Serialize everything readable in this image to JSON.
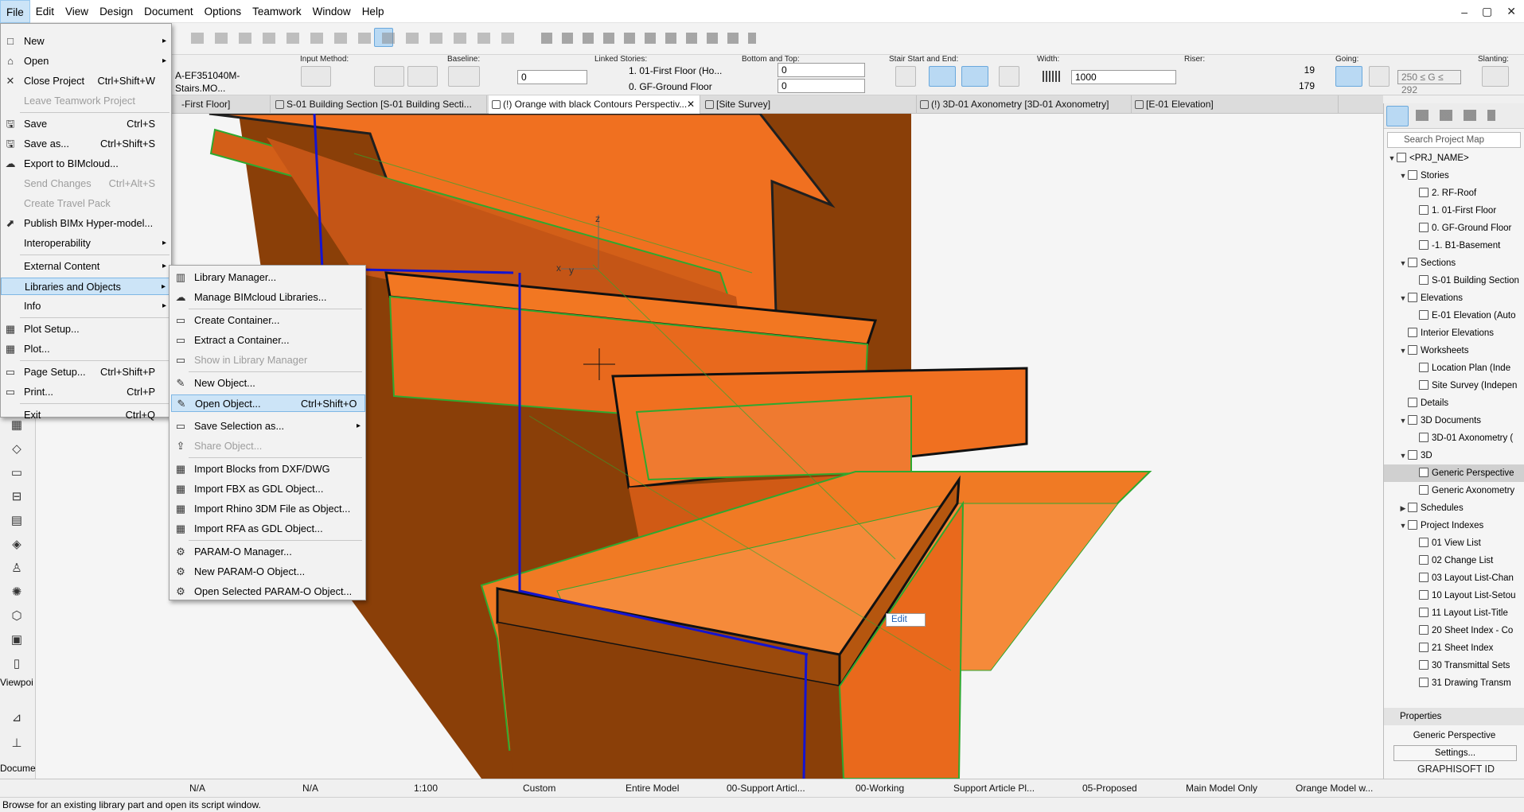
{
  "menubar": [
    "File",
    "Edit",
    "View",
    "Design",
    "Document",
    "Options",
    "Teamwork",
    "Window",
    "Help"
  ],
  "window_controls": [
    "–",
    "▢",
    "✕"
  ],
  "infobox": {
    "element_id": "A-EF351040M- Stairs.MO...",
    "sections": {
      "input_method": "Input Method:",
      "baseline": "Baseline:",
      "linked_stories": "Linked Stories:",
      "bottom_top": "Bottom and Top:",
      "stair_start_end": "Stair Start and End:",
      "width": "Width:",
      "riser": "Riser:",
      "going": "Going:",
      "slanting": "Slanting:"
    },
    "baseline_value": "0",
    "linked_story_top": "1. 01-First Floor (Ho...",
    "linked_story_bottom": "0. GF-Ground Floor",
    "bottom_value": "0",
    "top_value": "0",
    "width_value": "1000",
    "riser_count": "19",
    "riser_height": "179",
    "going_range": "250 ≤ G ≤ 292"
  },
  "tabs": [
    {
      "label": "-First Floor]"
    },
    {
      "label": "S-01 Building Section [S-01 Building Secti..."
    },
    {
      "label": "(!) Orange with black Contours Perspectiv...",
      "close": "✕"
    },
    {
      "label": "[Site Survey]"
    },
    {
      "label": "(!) 3D-01 Axonometry [3D-01 Axonometry]"
    },
    {
      "label": "[E-01 Elevation]"
    }
  ],
  "file_menu": {
    "items": [
      {
        "label": "New",
        "arrow": true
      },
      {
        "label": "Open",
        "arrow": true
      },
      {
        "label": "Close Project",
        "shortcut": "Ctrl+Shift+W"
      },
      {
        "label": "Leave Teamwork Project",
        "disabled": true
      },
      {
        "label": "Save",
        "shortcut": "Ctrl+S"
      },
      {
        "label": "Save as...",
        "shortcut": "Ctrl+Shift+S"
      },
      {
        "label": "Export to BIMcloud..."
      },
      {
        "label": "Send Changes",
        "shortcut": "Ctrl+Alt+S",
        "disabled": true
      },
      {
        "label": "Create Travel Pack",
        "disabled": true
      },
      {
        "label": "Publish BIMx Hyper-model..."
      },
      {
        "label": "Interoperability",
        "arrow": true
      },
      {
        "label": "External Content",
        "arrow": true
      },
      {
        "label": "Libraries and Objects",
        "arrow": true,
        "highlight": true
      },
      {
        "label": "Info",
        "arrow": true
      },
      {
        "label": "Plot Setup..."
      },
      {
        "label": "Plot..."
      },
      {
        "label": "Page Setup...",
        "shortcut": "Ctrl+Shift+P"
      },
      {
        "label": "Print...",
        "shortcut": "Ctrl+P"
      },
      {
        "label": "Exit",
        "shortcut": "Ctrl+Q"
      }
    ]
  },
  "libraries_submenu": {
    "items": [
      {
        "label": "Library Manager..."
      },
      {
        "label": "Manage BIMcloud Libraries..."
      },
      {
        "label": "Create Container..."
      },
      {
        "label": "Extract a Container..."
      },
      {
        "label": "Show in Library Manager",
        "disabled": true
      },
      {
        "label": "New Object..."
      },
      {
        "label": "Open Object...",
        "shortcut": "Ctrl+Shift+O",
        "highlight": true
      },
      {
        "label": "Save Selection as...",
        "arrow": true
      },
      {
        "label": "Share Object...",
        "disabled": true
      },
      {
        "label": "Import Blocks from DXF/DWG"
      },
      {
        "label": "Import FBX as GDL Object..."
      },
      {
        "label": "Import Rhino 3DM File as Object..."
      },
      {
        "label": "Import RFA as GDL Object..."
      },
      {
        "label": "PARAM-O Manager..."
      },
      {
        "label": "New PARAM-O Object..."
      },
      {
        "label": "Open Selected PARAM-O Object..."
      }
    ]
  },
  "leftbar": {
    "viewpoint_label": "Viewpoi",
    "document_label": "Docume"
  },
  "project_map": {
    "search_placeholder": "Search Project Map",
    "tree": [
      {
        "label": "<PRJ_NAME>",
        "level": 0,
        "caret": "open"
      },
      {
        "label": "Stories",
        "level": 1,
        "caret": "open"
      },
      {
        "label": "2. RF-Roof",
        "level": 2
      },
      {
        "label": "1. 01-First Floor",
        "level": 2
      },
      {
        "label": "0. GF-Ground Floor",
        "level": 2
      },
      {
        "label": "-1. B1-Basement",
        "level": 2
      },
      {
        "label": "Sections",
        "level": 1,
        "caret": "open"
      },
      {
        "label": "S-01 Building Section",
        "level": 2
      },
      {
        "label": "Elevations",
        "level": 1,
        "caret": "open"
      },
      {
        "label": "E-01 Elevation (Auto",
        "level": 2
      },
      {
        "label": "Interior Elevations",
        "level": 1
      },
      {
        "label": "Worksheets",
        "level": 1,
        "caret": "open"
      },
      {
        "label": "Location Plan (Inde",
        "level": 2
      },
      {
        "label": "Site Survey (Indepen",
        "level": 2
      },
      {
        "label": "Details",
        "level": 1
      },
      {
        "label": "3D Documents",
        "level": 1,
        "caret": "open"
      },
      {
        "label": "3D-01 Axonometry (",
        "level": 2
      },
      {
        "label": "3D",
        "level": 1,
        "caret": "open"
      },
      {
        "label": "Generic Perspective",
        "level": 2,
        "selected": true
      },
      {
        "label": "Generic Axonometry",
        "level": 2
      },
      {
        "label": "Schedules",
        "level": 1,
        "caret": "closed"
      },
      {
        "label": "Project Indexes",
        "level": 1,
        "caret": "open"
      },
      {
        "label": "01 View List",
        "level": 2
      },
      {
        "label": "02 Change List",
        "level": 2
      },
      {
        "label": "03 Layout List-Chan",
        "level": 2
      },
      {
        "label": "10 Layout List-Setou",
        "level": 2
      },
      {
        "label": "11 Layout List-Title",
        "level": 2
      },
      {
        "label": "20 Sheet Index - Co",
        "level": 2
      },
      {
        "label": "21 Sheet Index",
        "level": 2
      },
      {
        "label": "30 Transmittal Sets",
        "level": 2
      },
      {
        "label": "31 Drawing Transm",
        "level": 2
      }
    ],
    "properties_header": "Properties",
    "properties_value": "Generic Perspective",
    "settings_button": "Settings...",
    "brand": "GRAPHISOFT ID"
  },
  "bottombar": {
    "zoom1": "N/A",
    "zoom2": "N/A",
    "scale": "1:100",
    "layer_combo": "Custom",
    "model_view": "Entire Model",
    "pen_set": "00-Support Articl...",
    "dim": "00-Working",
    "renovation": "Support Article Pl...",
    "status": "05-Proposed",
    "filter": "Main Model Only",
    "graphic_override": "Orange Model w..."
  },
  "viewport": {
    "edit_label": "Edit",
    "axis_z": "z",
    "axis_x": "x",
    "axis_y": "y"
  },
  "status_text": "Browse for an existing library part and open its script window.",
  "colors": {
    "stair_orange": "#f07020",
    "stair_dark": "#8a3f08",
    "contour_green": "#2fa82f",
    "edge_blue": "#1414d0",
    "highlight": "#cce4f7"
  }
}
